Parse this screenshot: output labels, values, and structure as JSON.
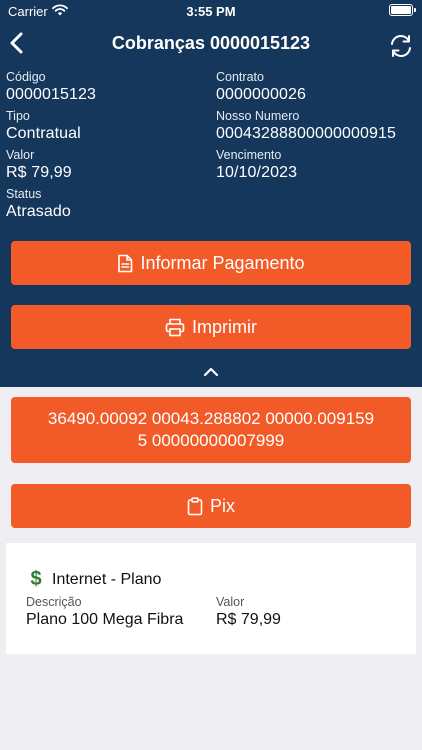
{
  "status_bar": {
    "carrier": "Carrier",
    "time": "3:55 PM"
  },
  "nav": {
    "title": "Cobranças 0000015123",
    "back_icon": "chevron-left-icon",
    "refresh_icon": "refresh-icon"
  },
  "details": {
    "codigo": {
      "label": "Código",
      "value": "0000015123"
    },
    "contrato": {
      "label": "Contrato",
      "value": "0000000026"
    },
    "tipo": {
      "label": "Tipo",
      "value": "Contratual"
    },
    "nosso_numero": {
      "label": "Nosso Numero",
      "value": "00043288800000000915"
    },
    "valor": {
      "label": "Valor",
      "value": "R$ 79,99"
    },
    "vencimento": {
      "label": "Vencimento",
      "value": "10/10/2023"
    },
    "status": {
      "label": "Status",
      "value": "Atrasado"
    }
  },
  "actions": {
    "informar_pagamento": "Informar Pagamento",
    "imprimir": "Imprimir",
    "barcode": "36490.00092 00043.288802 00000.009159\n5 00000000007999",
    "pix": "Pix"
  },
  "item": {
    "title": "Internet - Plano",
    "icon": "dollar-icon",
    "descricao": {
      "label": "Descrição",
      "value": "Plano 100 Mega Fibra"
    },
    "valor": {
      "label": "Valor",
      "value": "R$ 79,99"
    }
  },
  "colors": {
    "header": "#15375b",
    "accent": "#f25a28",
    "background": "#efeff3",
    "dollar": "#2e7d32"
  }
}
